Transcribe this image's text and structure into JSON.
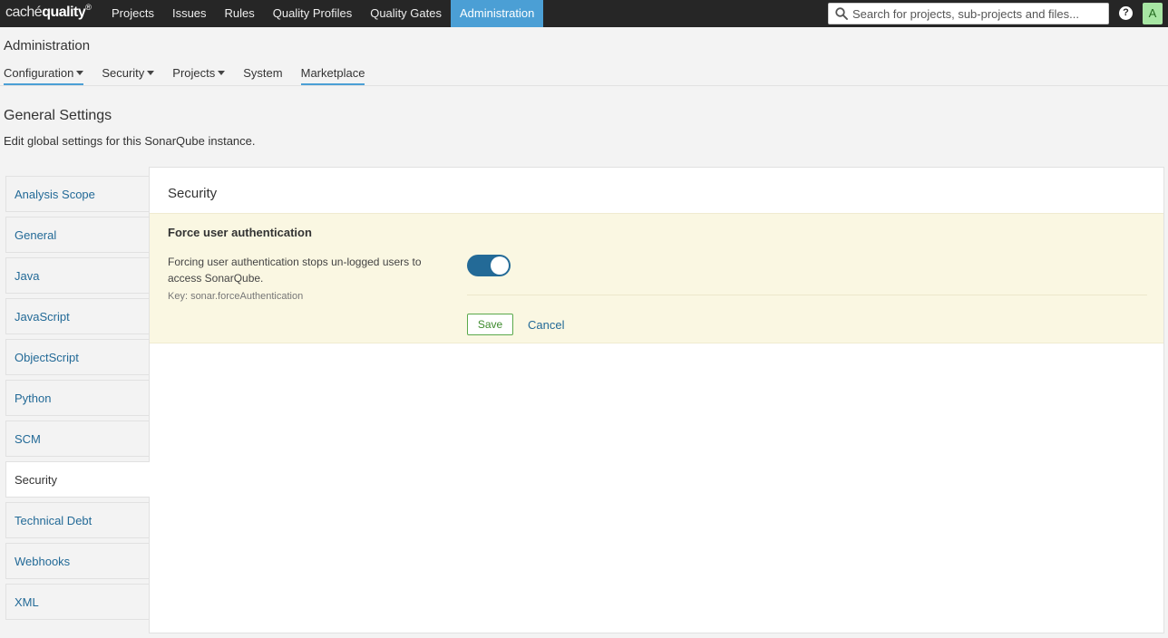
{
  "topbar": {
    "logo_light": "caché",
    "logo_bold": "quality",
    "logo_mark": "®",
    "nav": [
      "Projects",
      "Issues",
      "Rules",
      "Quality Profiles",
      "Quality Gates",
      "Administration"
    ],
    "active_nav": "Administration",
    "search_placeholder": "Search for projects, sub-projects and files...",
    "help_label": "?",
    "avatar_letter": "A"
  },
  "page": {
    "title": "Administration",
    "subnav": {
      "configuration": "Configuration",
      "security": "Security",
      "projects": "Projects",
      "system": "System",
      "marketplace": "Marketplace"
    }
  },
  "settings": {
    "title": "General Settings",
    "description": "Edit global settings for this SonarQube instance.",
    "categories": [
      "Analysis Scope",
      "General",
      "Java",
      "JavaScript",
      "ObjectScript",
      "Python",
      "SCM",
      "Security",
      "Technical Debt",
      "Webhooks",
      "XML"
    ],
    "active_category": "Security",
    "panel_title": "Security",
    "setting": {
      "name": "Force user authentication",
      "description": "Forcing user authentication stops un-logged users to access SonarQube.",
      "key": "Key: sonar.forceAuthentication",
      "toggle_on": true,
      "save_label": "Save",
      "cancel_label": "Cancel"
    }
  },
  "colors": {
    "topbar": "#262626",
    "accent": "#4b9fd5",
    "link": "#236a97",
    "setting_highlight": "#faf7e2",
    "save_green": "#5aa94b",
    "avatar_bg": "#a7e6a3"
  }
}
